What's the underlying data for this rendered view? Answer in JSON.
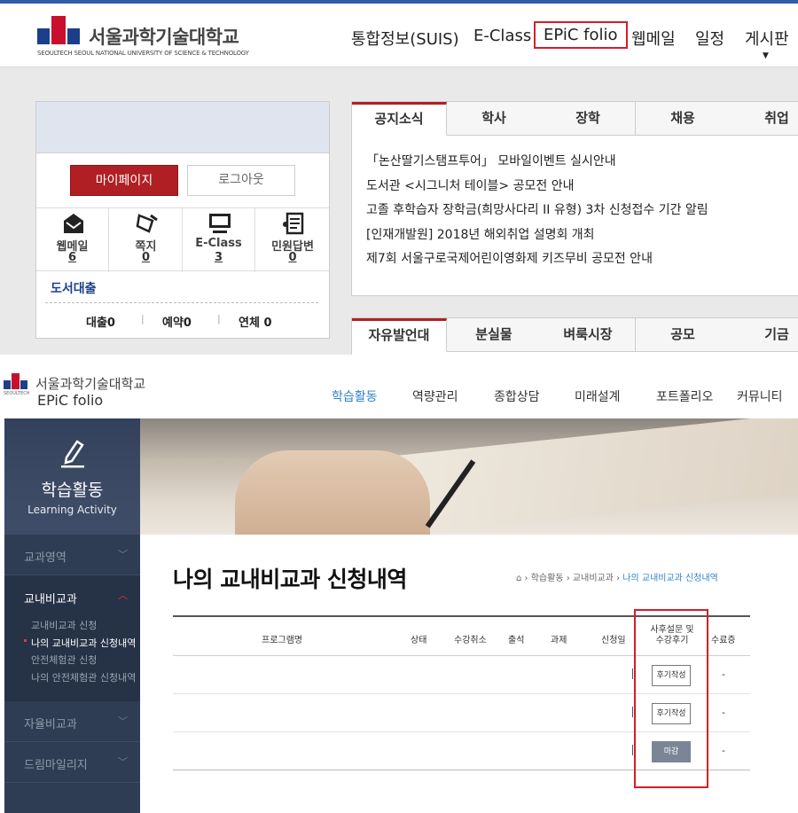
{
  "portal": {
    "logo_ko": "서울과학기술대학교",
    "logo_en": "SEOULTECH  SEOUL NATIONAL UNIVERSITY OF SCIENCE & TECHNOLOGY",
    "nav": [
      "통합정보(SUIS)",
      "E-Class",
      "EPiC folio",
      "웹메일",
      "일정",
      "게시판"
    ],
    "mypage_label": "마이페이지",
    "logout_label": "로그아웃",
    "quick": [
      {
        "label": "웹메일",
        "count": "6",
        "icon": "mail-icon"
      },
      {
        "label": "쪽지",
        "count": "0",
        "icon": "note-icon"
      },
      {
        "label": "E-Class",
        "count": "3",
        "icon": "monitor-icon"
      },
      {
        "label": "민원답변",
        "count": "0",
        "icon": "document-icon"
      }
    ],
    "library_title": "도서대출",
    "library_stats": [
      "대출0",
      "예약0",
      "연체 0"
    ],
    "notice_tabs": [
      "공지소식",
      "학사",
      "장학",
      "채용",
      "취업"
    ],
    "notices": [
      "「논산딸기스탬프투어」 모바일이벤트 실시안내",
      "도서관 <시그니처 테이블> 공모전 안내",
      "고졸 후학습자 장학금(희망사다리 II 유형) 3차 신청접수 기간 알림",
      "[인재개발원] 2018년 해외취업 설명회 개최",
      "제7회 서울구로국제어린이영화제 키즈무비 공모전 안내"
    ],
    "board_tabs": [
      "자유발언대",
      "분실물",
      "벼룩시장",
      "공모",
      "기금"
    ]
  },
  "epic": {
    "logo_tiny": "SEOULTECH",
    "logo_ko": "서울과학기술대학교",
    "logo_sub": "EPiC folio",
    "nav": [
      "학습활동",
      "역량관리",
      "종합상담",
      "미래설계",
      "포트폴리오",
      "커뮤니티"
    ],
    "hero_title": "학습활동",
    "hero_subtitle": "Learning Activity",
    "side": {
      "item1": "교과영역",
      "open_label": "교내비교과",
      "subs": [
        "교내비교과 신청",
        "나의 교내비교과 신청내역",
        "안전체험관 신청",
        "나의 안전체험관 신청내역"
      ],
      "item3": "자율비교과",
      "item4": "드림마일리지"
    },
    "page_title": "나의 교내비교과 신청내역",
    "breadcrumb": [
      "학습활동",
      "교내비교과",
      "나의 교내비교과 신청내역"
    ],
    "table": {
      "headers": [
        "프로그램명",
        "상태",
        "수강취소",
        "출석",
        "과제",
        "신청일",
        "사후설문 및",
        "수강후기",
        "수료증"
      ],
      "rows": [
        {
          "action": "후기작성",
          "cert": "-"
        },
        {
          "action": "후기작성",
          "cert": "-"
        },
        {
          "action": "마감",
          "cert": "-"
        }
      ]
    }
  }
}
